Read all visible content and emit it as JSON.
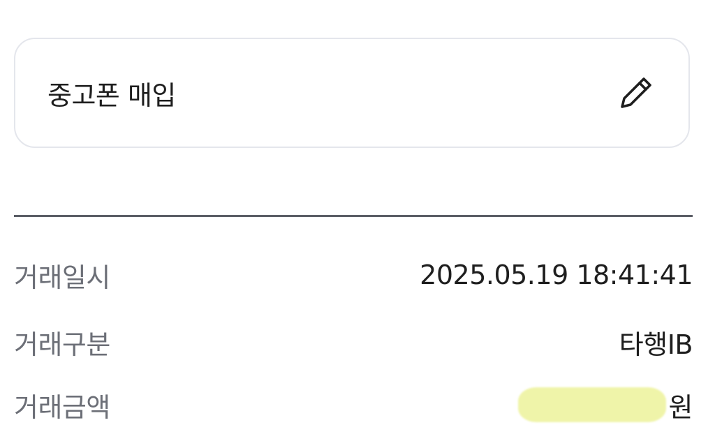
{
  "memo": {
    "text": "중고폰 매입",
    "edit_icon": "pencil-icon"
  },
  "details": {
    "datetime_label": "거래일시",
    "datetime_value": "2025.05.19 18:41:41",
    "type_label": "거래구분",
    "type_value": "타행IB",
    "amount_label": "거래금액",
    "amount_unit": "원"
  },
  "colors": {
    "border": "#e4e6ec",
    "divider": "#5b5e66",
    "label_text": "#6c6f77",
    "value_text": "#1e1e1e",
    "redaction_highlight": "#eef3a0"
  }
}
